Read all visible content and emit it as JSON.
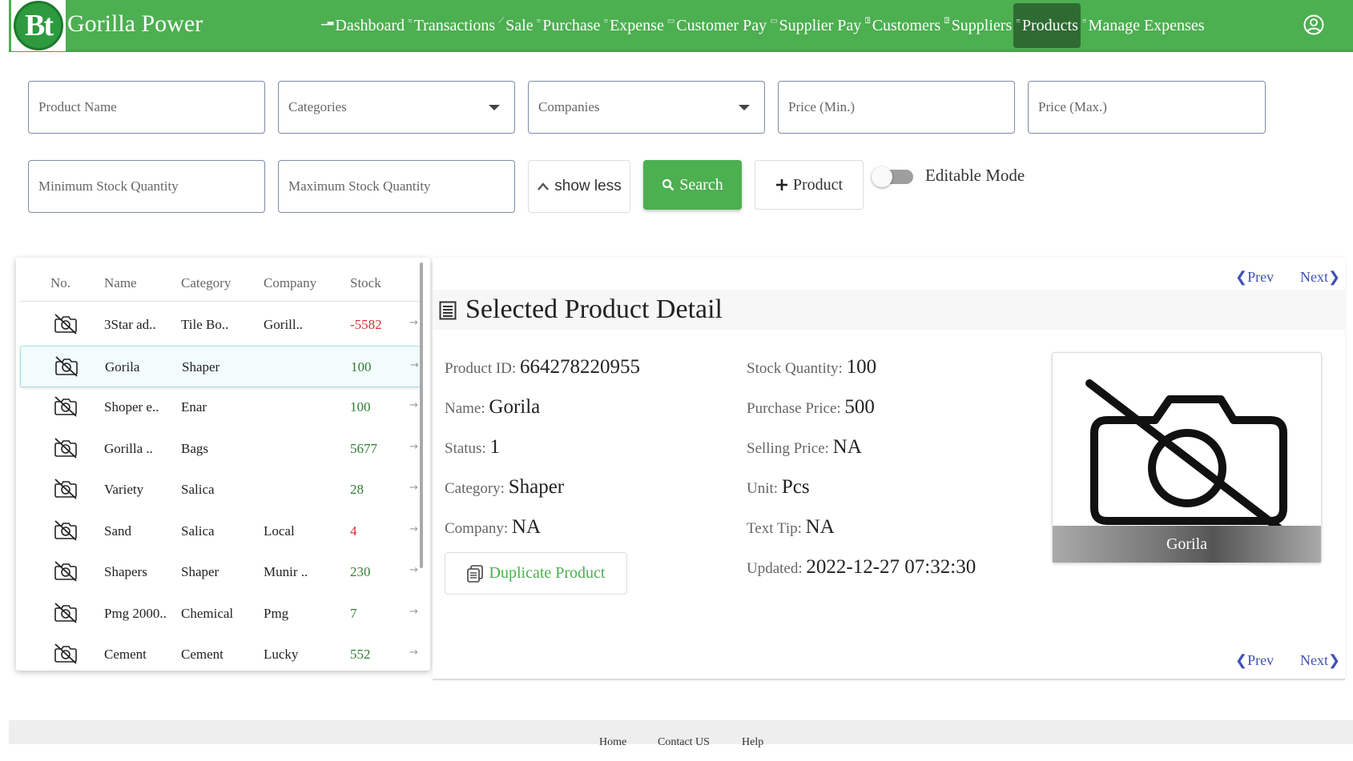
{
  "app": {
    "logo_text": "Bt",
    "brand": "Gorilla Power"
  },
  "nav": {
    "items": [
      {
        "label": "Dashboard",
        "icon": "chart-icon"
      },
      {
        "label": "Transactions",
        "icon": "list-icon"
      },
      {
        "label": "Sale",
        "icon": "line-chart-icon"
      },
      {
        "label": "Purchase",
        "icon": "list-icon"
      },
      {
        "label": "Expense",
        "icon": "list-icon"
      },
      {
        "label": "Customer Pay",
        "icon": "card-icon"
      },
      {
        "label": "Supplier Pay",
        "icon": "card-icon"
      },
      {
        "label": "Customers",
        "icon": "people-icon"
      },
      {
        "label": "Suppliers",
        "icon": "people-icon"
      },
      {
        "label": "Products",
        "icon": "list-icon",
        "active": true
      },
      {
        "label": "Manage Expenses",
        "icon": "list-icon"
      }
    ],
    "user_icon": "user-circle-icon"
  },
  "filters": {
    "product_name_placeholder": "Product Name",
    "categories_placeholder": "Categories",
    "companies_placeholder": "Companies",
    "price_min_placeholder": "Price (Min.)",
    "price_max_placeholder": "Price (Max.)",
    "min_stock_placeholder": "Minimum Stock Quantity",
    "max_stock_placeholder": "Maximum Stock Quantity",
    "show_less_label": "show less",
    "search_label": "Search",
    "add_product_label": "Product",
    "editable_mode_label": "Editable Mode",
    "editable_mode_on": false
  },
  "product_list": {
    "headers": {
      "no": "No.",
      "name": "Name",
      "category": "Category",
      "company": "Company",
      "stock": "Stock"
    },
    "rows": [
      {
        "name": "3Star ad..",
        "category": "Tile Bo..",
        "company": "Gorill..",
        "stock": "-5582",
        "stock_color": "#d32f2f"
      },
      {
        "name": "Gorila",
        "category": "Shaper",
        "company": "",
        "stock": "100",
        "stock_color": "#2e7d32",
        "selected": true
      },
      {
        "name": "Shoper e..",
        "category": "Enar",
        "company": "",
        "stock": "100",
        "stock_color": "#2e7d32"
      },
      {
        "name": "Gorilla ..",
        "category": "Bags",
        "company": "",
        "stock": "5677",
        "stock_color": "#2e7d32"
      },
      {
        "name": "Variety",
        "category": "Salica",
        "company": "",
        "stock": "28",
        "stock_color": "#2e7d32"
      },
      {
        "name": "Sand",
        "category": "Salica",
        "company": "Local",
        "stock": "4",
        "stock_color": "#d32f2f"
      },
      {
        "name": "Shapers",
        "category": "Shaper",
        "company": "Munir ..",
        "stock": "230",
        "stock_color": "#2e7d32"
      },
      {
        "name": "Pmg 2000..",
        "category": "Chemical",
        "company": "Pmg",
        "stock": "7",
        "stock_color": "#2e7d32"
      },
      {
        "name": "Cement",
        "category": "Cement",
        "company": "Lucky",
        "stock": "552",
        "stock_color": "#2e7d32"
      }
    ]
  },
  "detail": {
    "prev_label": "❮Prev",
    "next_label": "Next❯",
    "title": "Selected Product Detail",
    "product_id_label": "Product ID:",
    "product_id": "664278220955",
    "name_label": "Name:",
    "name": "Gorila",
    "status_label": "Status:",
    "status": "1",
    "category_label": "Category:",
    "category": "Shaper",
    "company_label": "Company:",
    "company": "NA",
    "stock_qty_label": "Stock Quantity:",
    "stock_qty": "100",
    "purchase_price_label": "Purchase Price:",
    "purchase_price": "500",
    "selling_price_label": "Selling Price:",
    "selling_price": "NA",
    "unit_label": "Unit:",
    "unit": "Pcs",
    "text_tip_label": "Text Tip:",
    "text_tip": "NA",
    "updated_label": "Updated:",
    "updated": "2022-12-27 07:32:30",
    "duplicate_label": "Duplicate Product",
    "image_caption": "Gorila"
  },
  "footer": {
    "home": "Home",
    "contact": "Contact US",
    "help": "Help"
  }
}
